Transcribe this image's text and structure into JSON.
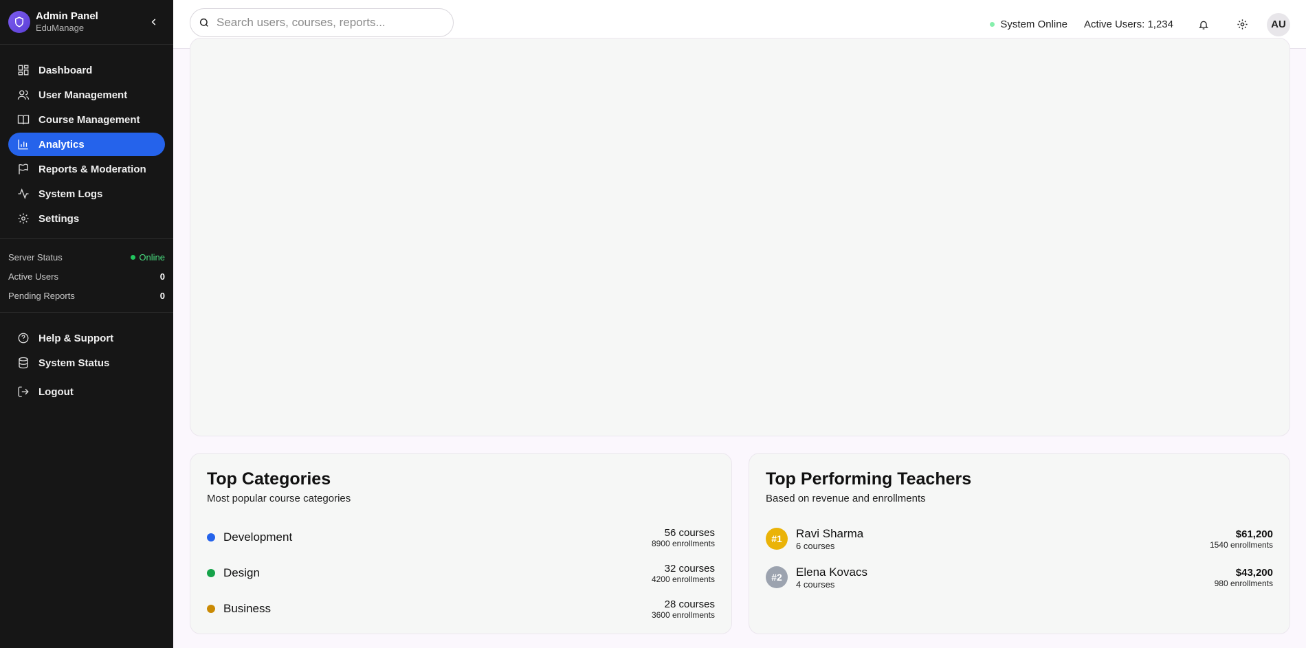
{
  "sidebar": {
    "brand_title": "Admin Panel",
    "brand_subtitle": "EduManage",
    "nav": [
      {
        "label": "Dashboard",
        "icon": "dashboard-icon"
      },
      {
        "label": "User Management",
        "icon": "users-icon"
      },
      {
        "label": "Course Management",
        "icon": "book-icon"
      },
      {
        "label": "Analytics",
        "icon": "bar-chart-icon",
        "active": true
      },
      {
        "label": "Reports & Moderation",
        "icon": "flag-icon"
      },
      {
        "label": "System Logs",
        "icon": "activity-icon"
      },
      {
        "label": "Settings",
        "icon": "gear-icon"
      }
    ],
    "stats": [
      {
        "label": "Server Status",
        "value": "Online"
      },
      {
        "label": "Active Users",
        "value": "0"
      },
      {
        "label": "Pending Reports",
        "value": "0"
      }
    ],
    "bottom_nav": [
      {
        "label": "Help & Support",
        "icon": "help-circle-icon"
      },
      {
        "label": "System Status",
        "icon": "database-icon"
      },
      {
        "label": "Logout",
        "icon": "logout-icon"
      }
    ]
  },
  "header": {
    "search_placeholder": "Search users, courses, reports...",
    "system_status": "System Online",
    "active_users": "Active Users: 1,234",
    "avatar_initials": "AU"
  },
  "categories": {
    "title": "Top Categories",
    "subtitle": "Most popular course categories",
    "items": [
      {
        "name": "Development",
        "courses": "56 courses",
        "enrollments": "8900 enrollments",
        "color": "#2563eb"
      },
      {
        "name": "Design",
        "courses": "32 courses",
        "enrollments": "4200 enrollments",
        "color": "#16a34a"
      },
      {
        "name": "Business",
        "courses": "28 courses",
        "enrollments": "3600 enrollments",
        "color": "#ca8a04"
      }
    ]
  },
  "teachers": {
    "title": "Top Performing Teachers",
    "subtitle": "Based on revenue and enrollments",
    "items": [
      {
        "rank": "#1",
        "name": "Ravi Sharma",
        "courses": "6 courses",
        "revenue": "$61,200",
        "enrollments": "1540 enrollments",
        "color": "#eab308"
      },
      {
        "rank": "#2",
        "name": "Elena Kovacs",
        "courses": "4 courses",
        "revenue": "$43,200",
        "enrollments": "980 enrollments",
        "color": "#9ca3af"
      }
    ]
  },
  "colors": {
    "accent": "#2563eb",
    "online": "#4ade80",
    "sidebar_bg": "#161616"
  }
}
